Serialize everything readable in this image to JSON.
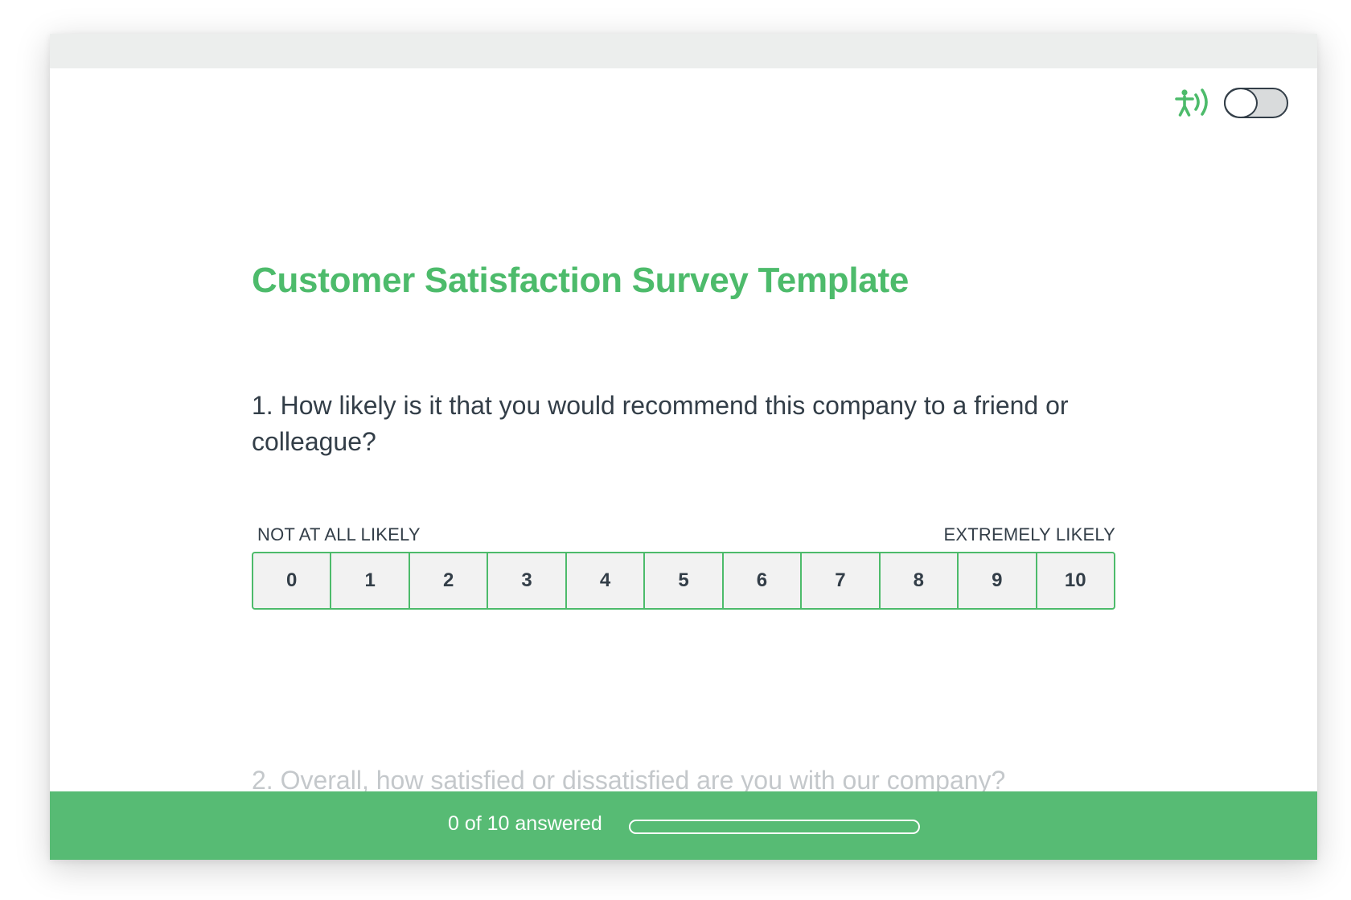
{
  "survey": {
    "title": "Customer Satisfaction Survey Template"
  },
  "accessibility": {
    "icon": "accessibility-audio-icon",
    "toggle_on": false,
    "accent_color": "#4dbb6b"
  },
  "question1": {
    "text": "1. How likely is it that you would recommend this company to a friend or colleague?",
    "low_label": "NOT AT ALL LIKELY",
    "high_label": "EXTREMELY LIKELY",
    "options": [
      "0",
      "1",
      "2",
      "3",
      "4",
      "5",
      "6",
      "7",
      "8",
      "9",
      "10"
    ]
  },
  "question2": {
    "text": "2. Overall, how satisfied or dissatisfied are you with our company?"
  },
  "progress": {
    "text": "0 of 10 answered",
    "answered": 0,
    "total": 10
  },
  "colors": {
    "brand_green": "#4dbb6b",
    "footer_green": "#57bb74",
    "text_dark": "#333e48",
    "text_muted": "#c4c8cb"
  }
}
